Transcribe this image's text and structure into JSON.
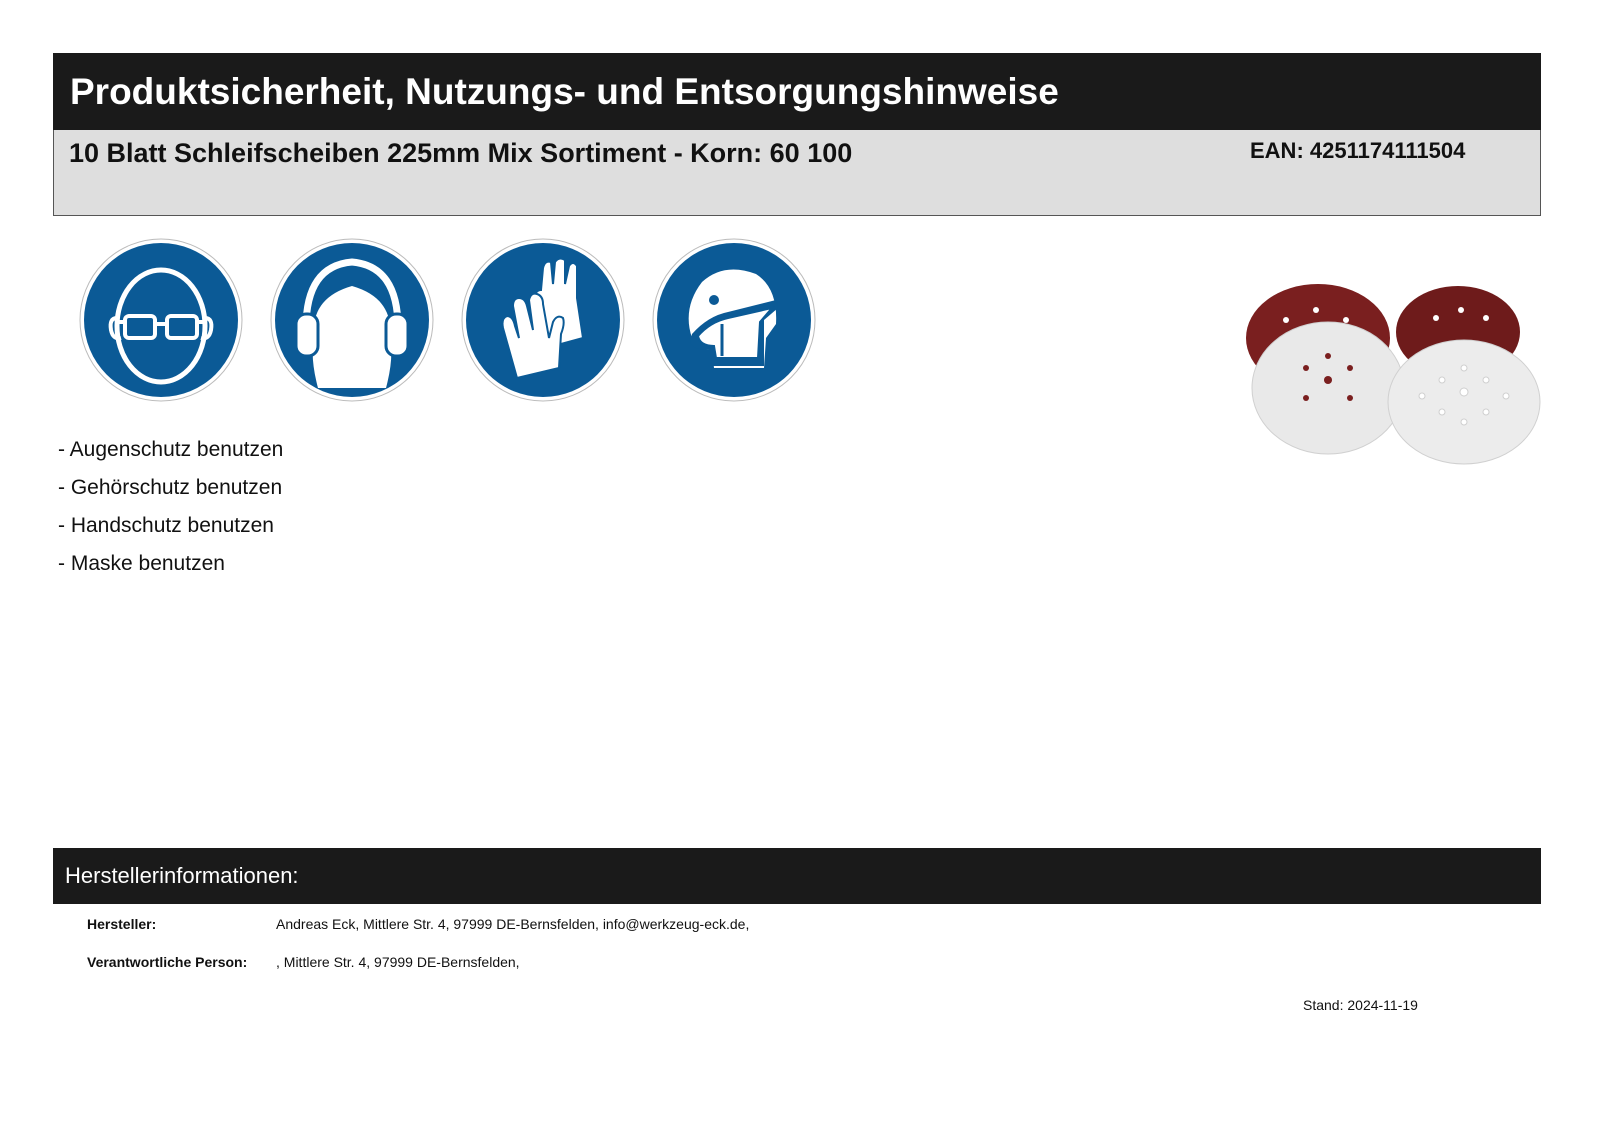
{
  "header": {
    "title": "Produktsicherheit, Nutzungs- und Entsorgungshinweise",
    "product_name": "10 Blatt Schleifscheiben 225mm Mix Sortiment - Korn: 60 100",
    "ean": "EAN: 4251174111504"
  },
  "safety_signs": {
    "icons": [
      "eye-protection-icon",
      "hearing-protection-icon",
      "hand-protection-icon",
      "mask-icon"
    ],
    "sign_color": "#0b5a96"
  },
  "rules": [
    "- Augenschutz benutzen",
    "- Gehörschutz benutzen",
    "- Handschutz benutzen",
    "- Maske benutzen"
  ],
  "manufacturer": {
    "heading": "Herstellerinformationen:",
    "rows": [
      {
        "label": "Hersteller:",
        "value": "Andreas Eck, Mittlere Str. 4, 97999 DE-Bernsfelden, info@werkzeug-eck.de,"
      },
      {
        "label": "Verantwortliche Person:",
        "value": ", Mittlere Str. 4, 97999 DE-Bernsfelden,"
      }
    ]
  },
  "footer": {
    "stand": "Stand: 2024-11-19"
  }
}
